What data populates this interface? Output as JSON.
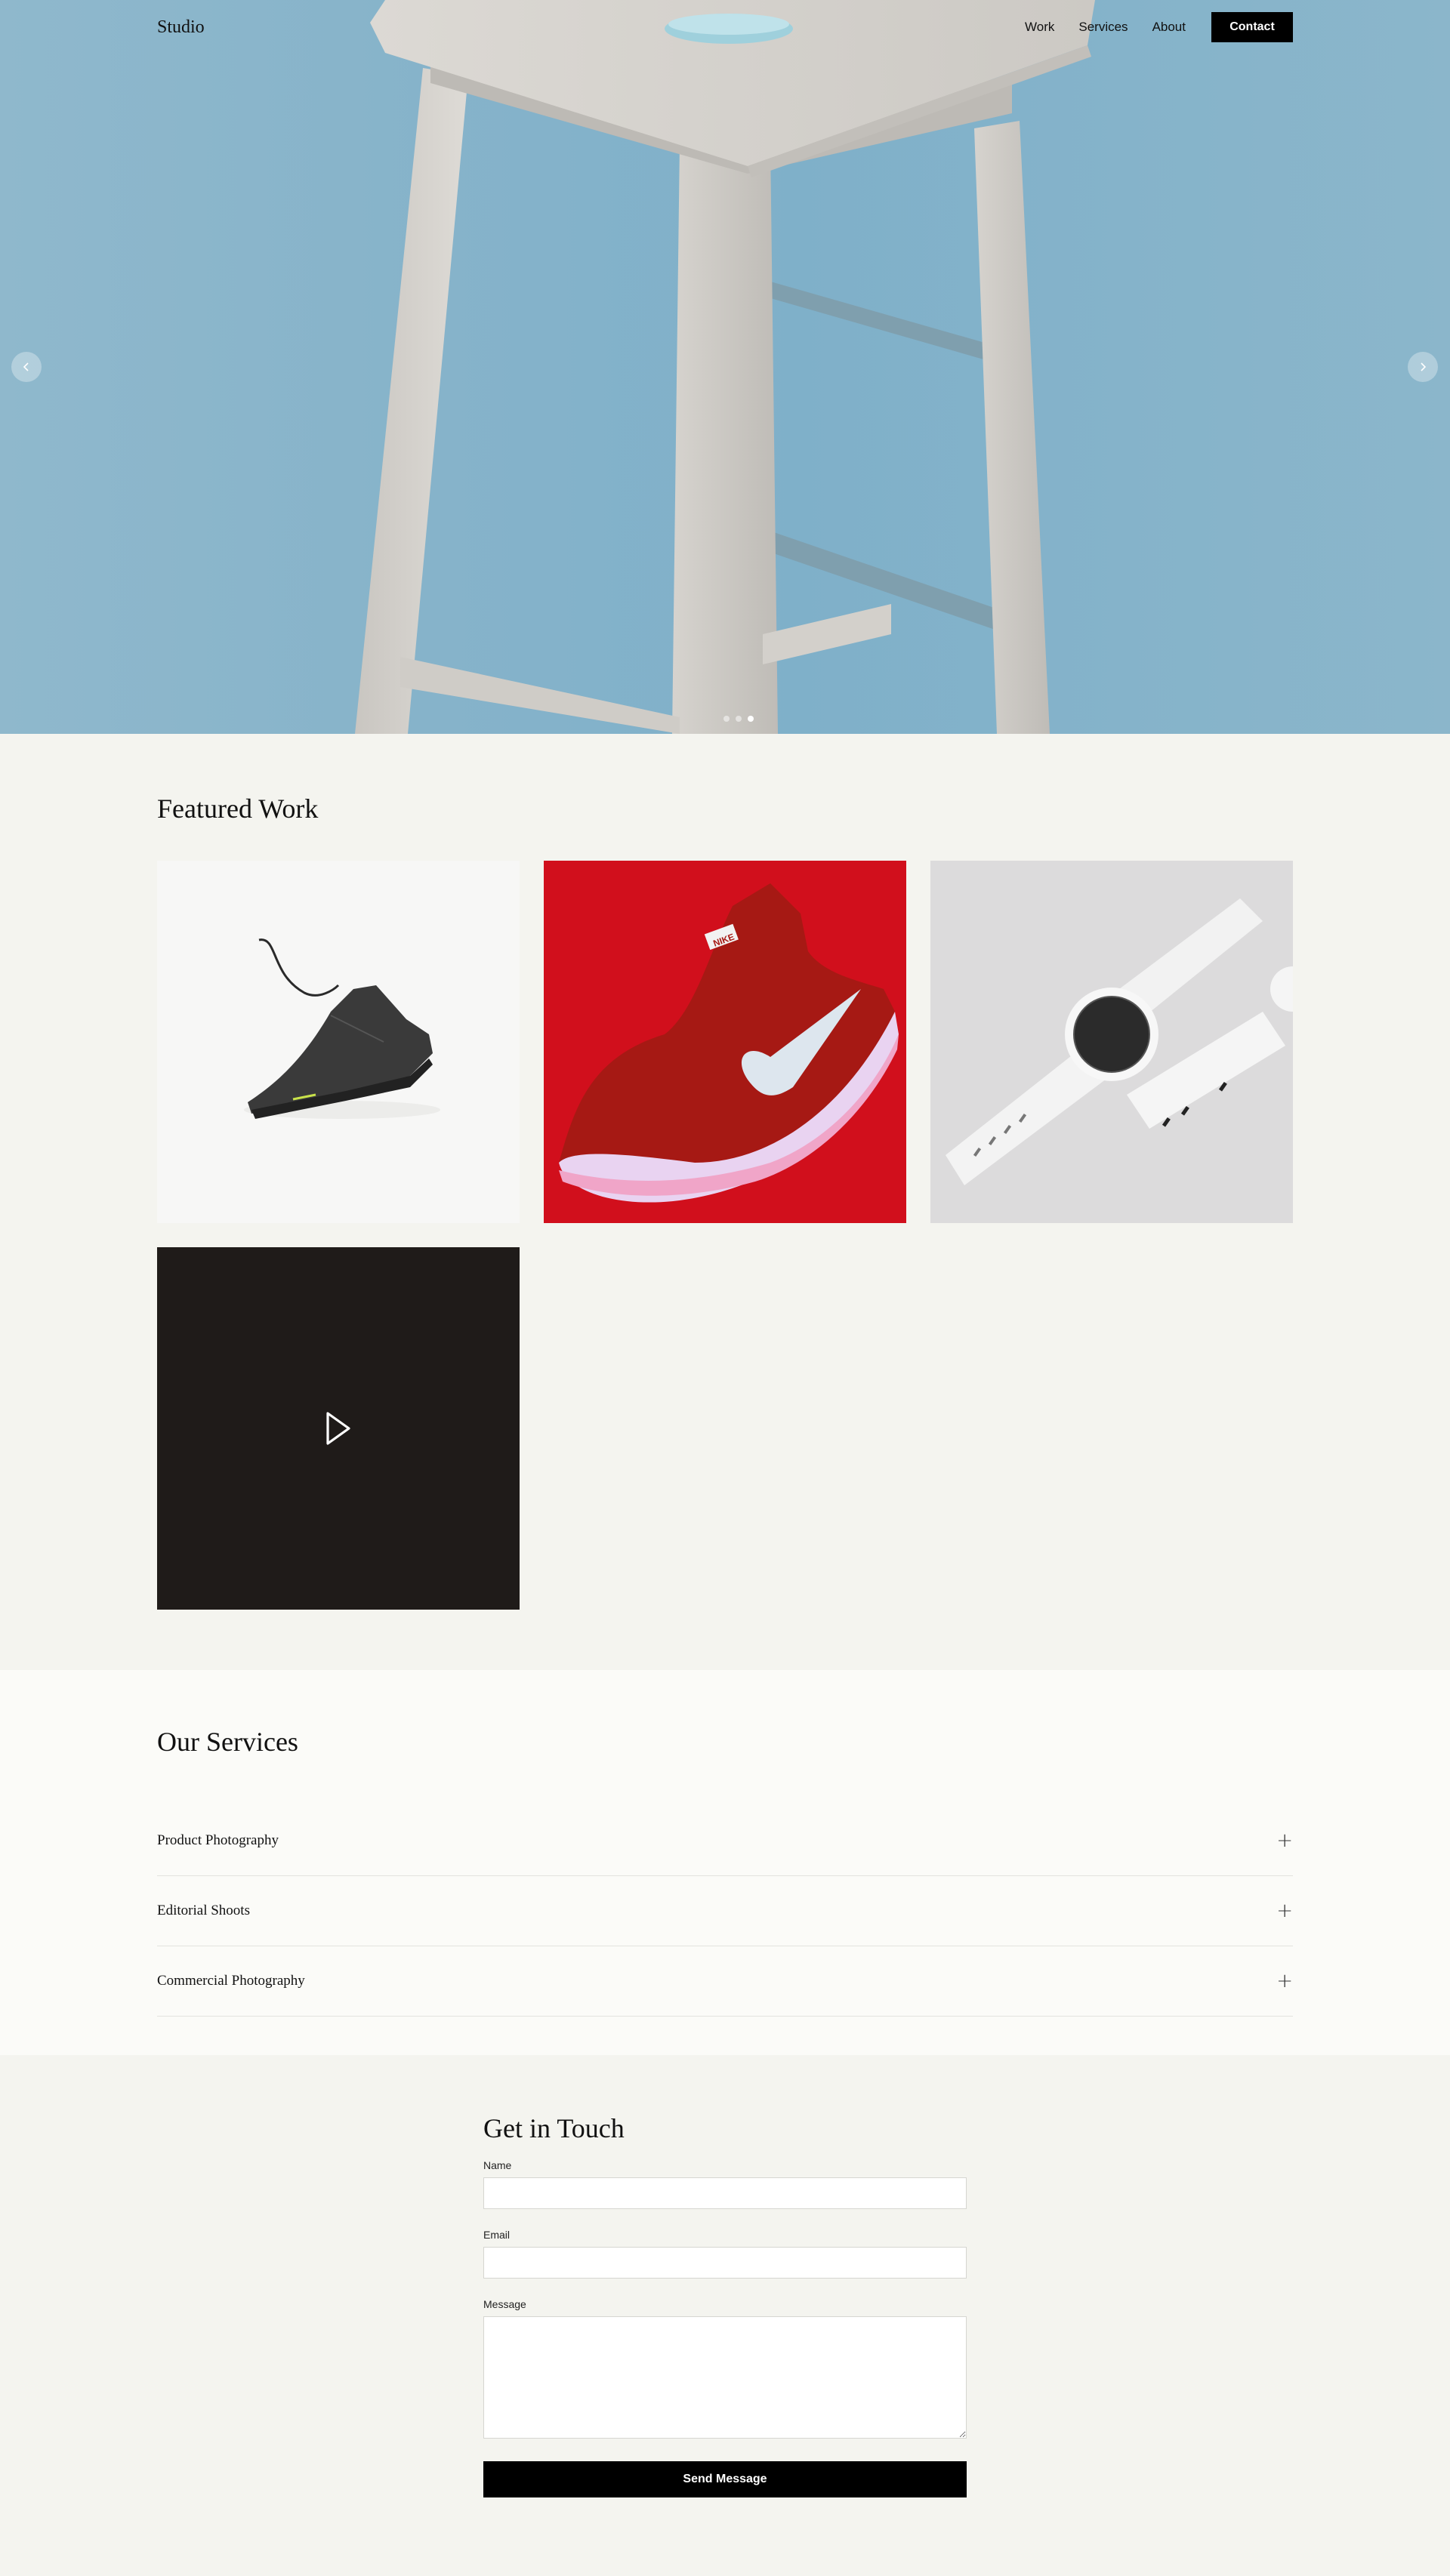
{
  "header": {
    "logo": "Studio",
    "nav": [
      {
        "label": "Work"
      },
      {
        "label": "Services"
      },
      {
        "label": "About"
      }
    ],
    "contact_label": "Contact"
  },
  "hero": {
    "prev_icon": "chevron-left-icon",
    "next_icon": "chevron-right-icon",
    "slide_count": 3,
    "active_slide": 3,
    "background_color": "#85b3ca"
  },
  "featured": {
    "title": "Featured Work",
    "items": [
      {
        "name": "black sneaker photo"
      },
      {
        "name": "red nike sneaker photo",
        "brand_mark": "NIKE"
      },
      {
        "name": "white smartwatch photo"
      },
      {
        "name": "video tile",
        "icon": "play-icon"
      }
    ]
  },
  "services": {
    "title": "Our Services",
    "items": [
      {
        "label": "Product Photography",
        "icon": "plus-icon"
      },
      {
        "label": "Editorial Shoots",
        "icon": "plus-icon"
      },
      {
        "label": "Commercial Photography",
        "icon": "plus-icon"
      }
    ]
  },
  "contact": {
    "title": "Get in Touch",
    "name_label": "Name",
    "name_value": "",
    "email_label": "Email",
    "email_value": "",
    "message_label": "Message",
    "message_value": "",
    "submit_label": "Send Message"
  }
}
